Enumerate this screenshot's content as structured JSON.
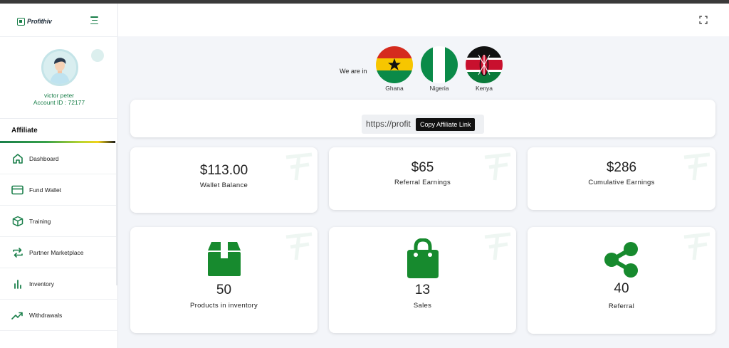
{
  "brand": {
    "name": "Profithiv",
    "accent": "#1a7f4a"
  },
  "profile": {
    "name": "victor peter",
    "account_id": "Account ID : 72177"
  },
  "sidebar": {
    "section": "Affiliate",
    "items": [
      {
        "label": "Dashboard",
        "icon": "home-icon"
      },
      {
        "label": "Fund Wallet",
        "icon": "wallet-card-icon"
      },
      {
        "label": "Training",
        "icon": "box-icon"
      },
      {
        "label": "Partner Marketplace",
        "icon": "exchange-arrows-icon"
      },
      {
        "label": "Inventory",
        "icon": "bar-chart-icon"
      },
      {
        "label": "Withdrawals",
        "icon": "trending-up-icon"
      }
    ]
  },
  "countries": {
    "intro": "We are in",
    "list": [
      {
        "name": "Ghana"
      },
      {
        "name": "Nigeria"
      },
      {
        "name": "Kenya"
      }
    ]
  },
  "affiliate": {
    "link_value": "https://profit",
    "tooltip": "Copy Affiliate Link"
  },
  "stats": [
    {
      "value": "$113.00",
      "label": "Wallet Balance"
    },
    {
      "value": "$65",
      "label": "Referral Earnings"
    },
    {
      "value": "$286",
      "label": "Cumulative Earnings"
    }
  ],
  "tiles": [
    {
      "value": "50",
      "label": "Products in inventory",
      "icon": "package-box-icon"
    },
    {
      "value": "13",
      "label": "Sales",
      "icon": "shopping-bag-icon"
    },
    {
      "value": "40",
      "label": "Referral",
      "icon": "share-icon"
    }
  ]
}
